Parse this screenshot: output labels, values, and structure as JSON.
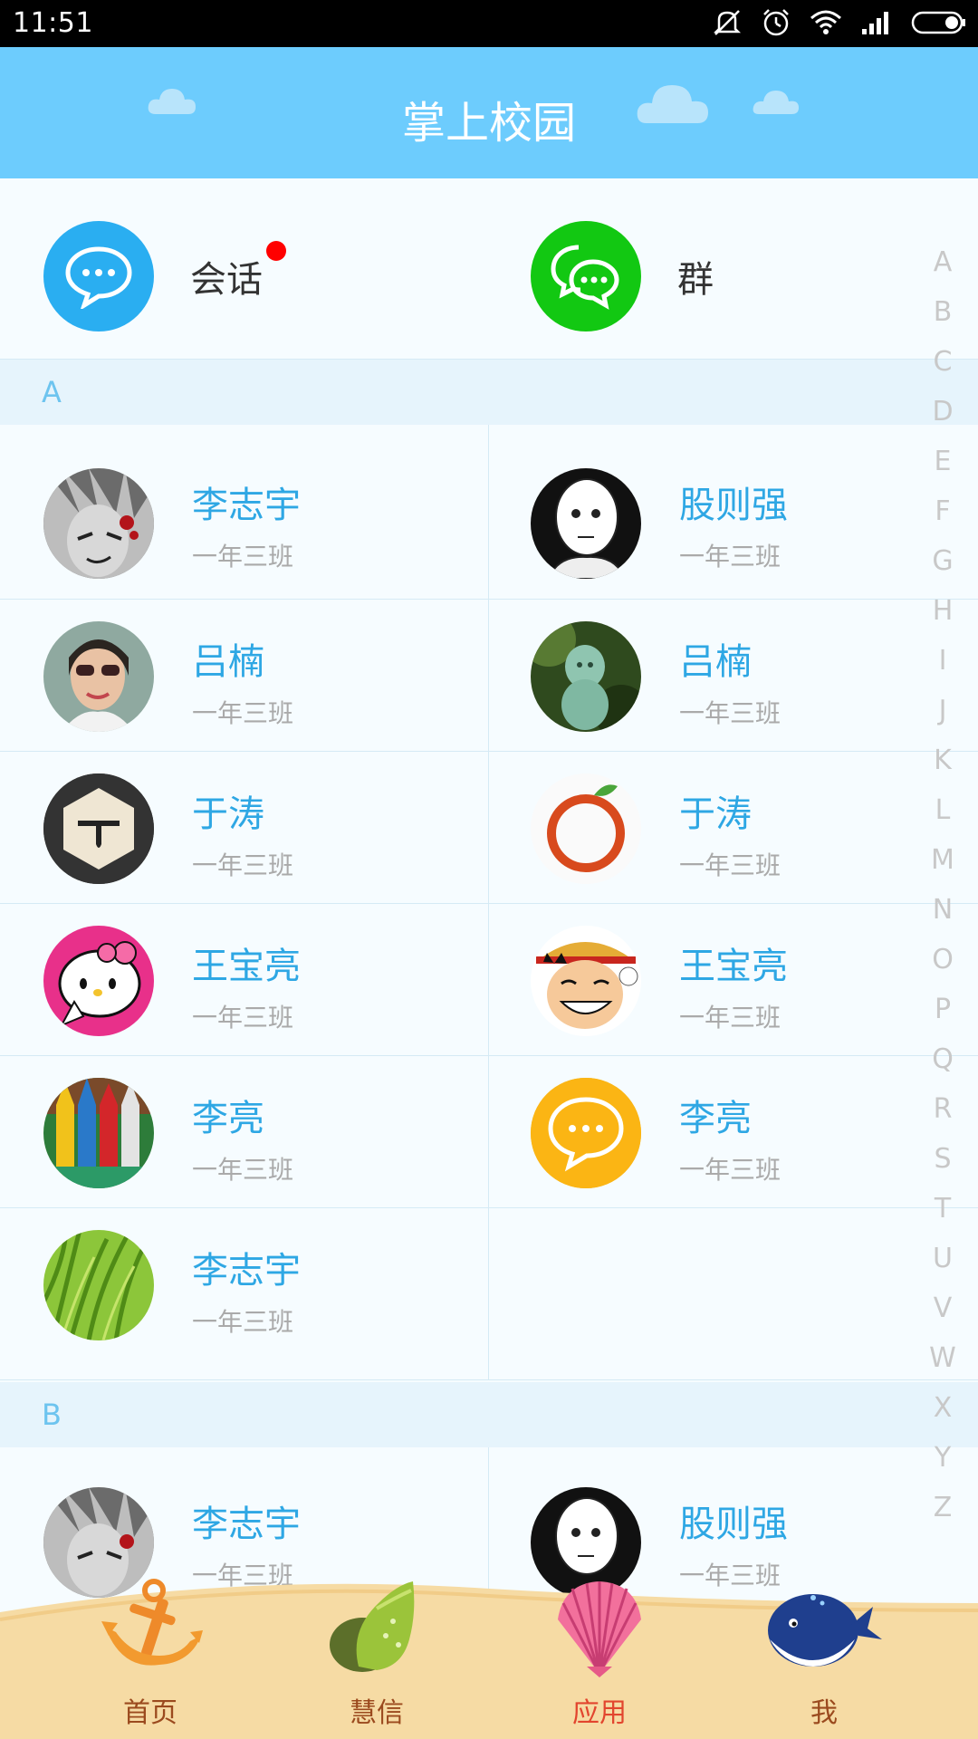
{
  "status": {
    "time": "11:51"
  },
  "header": {
    "title": "掌上校园"
  },
  "shortcuts": [
    {
      "label": "会话",
      "icon": "chat-icon",
      "color": "#2aaef1",
      "badge": true
    },
    {
      "label": "群",
      "icon": "group-chat-icon",
      "color": "#12c812",
      "badge": false
    }
  ],
  "sections": [
    {
      "letter": "A",
      "contacts": [
        {
          "name": "李志宇",
          "class": "一年三班",
          "avatar": "anime-gray"
        },
        {
          "name": "股则强",
          "class": "一年三班",
          "avatar": "saitama"
        },
        {
          "name": "吕楠",
          "class": "一年三班",
          "avatar": "woman-sunglasses"
        },
        {
          "name": "吕楠",
          "class": "一年三班",
          "avatar": "green-figure"
        },
        {
          "name": "于涛",
          "class": "一年三班",
          "avatar": "hexagon-dark"
        },
        {
          "name": "于涛",
          "class": "一年三班",
          "avatar": "orange-ring"
        },
        {
          "name": "王宝亮",
          "class": "一年三班",
          "avatar": "hello-kitty"
        },
        {
          "name": "王宝亮",
          "class": "一年三班",
          "avatar": "luffy"
        },
        {
          "name": "李亮",
          "class": "一年三班",
          "avatar": "pencils"
        },
        {
          "name": "李亮",
          "class": "一年三班",
          "avatar": "yellow-chat"
        },
        {
          "name": "李志宇",
          "class": "一年三班",
          "avatar": "grass"
        }
      ]
    },
    {
      "letter": "B",
      "contacts": [
        {
          "name": "李志宇",
          "class": "一年三班",
          "avatar": "anime-gray"
        },
        {
          "name": "股则强",
          "class": "一年三班",
          "avatar": "saitama"
        }
      ]
    }
  ],
  "alphabet": [
    "A",
    "B",
    "C",
    "D",
    "E",
    "F",
    "G",
    "H",
    "I",
    "J",
    "K",
    "L",
    "M",
    "N",
    "O",
    "P",
    "Q",
    "R",
    "S",
    "T",
    "U",
    "V",
    "W",
    "X",
    "Y",
    "Z"
  ],
  "nav": [
    {
      "label": "首页",
      "icon": "anchor-icon",
      "active": false
    },
    {
      "label": "慧信",
      "icon": "conch-icon",
      "active": false
    },
    {
      "label": "应用",
      "icon": "seashell-icon",
      "active": true
    },
    {
      "label": "我",
      "icon": "whale-icon",
      "active": false
    }
  ],
  "colors": {
    "header": "#6dccfd",
    "accent": "#2ea7e4",
    "active_nav": "#e2452e",
    "nav_text": "#9b4a1e"
  }
}
